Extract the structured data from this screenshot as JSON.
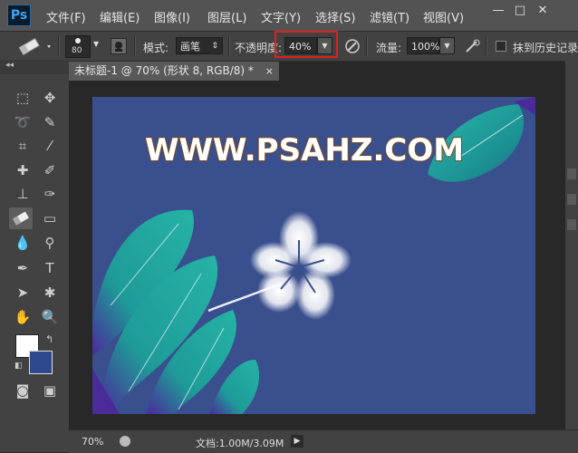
{
  "app": {
    "logo": "Ps"
  },
  "menu": [
    "文件(F)",
    "编辑(E)",
    "图像(I)",
    "图层(L)",
    "文字(Y)",
    "选择(S)",
    "滤镜(T)",
    "视图(V)"
  ],
  "window_controls": {
    "minimize": "—",
    "restore": "□",
    "close": "✕"
  },
  "options": {
    "brush_size": "80",
    "mode_label": "模式:",
    "mode_value": "画笔",
    "opacity_label": "不透明度:",
    "opacity_value": "40%",
    "flow_label": "流量:",
    "flow_value": "100%",
    "history_label": "抹到历史记录"
  },
  "document": {
    "tab_title": "未标题-1 @ 70% (形状 8, RGB/8) *",
    "tab_close": "×",
    "canvas_text": "WWW.PSAHZ.COM"
  },
  "status": {
    "zoom": "70%",
    "doc_info": "文档:1.00M/3.09M"
  },
  "colors": {
    "canvas_bg": "#3a4f8d",
    "foreground": "#ffffff",
    "background": "#2f4a8c",
    "leaf_teal": "#1fa8a0",
    "accent_purple": "#4b2a9a",
    "highlight": "#e02020"
  },
  "icons": {
    "eraser": "eraser-icon",
    "brush_preset": "brush-preset-icon",
    "airbrush": "airbrush-icon"
  }
}
